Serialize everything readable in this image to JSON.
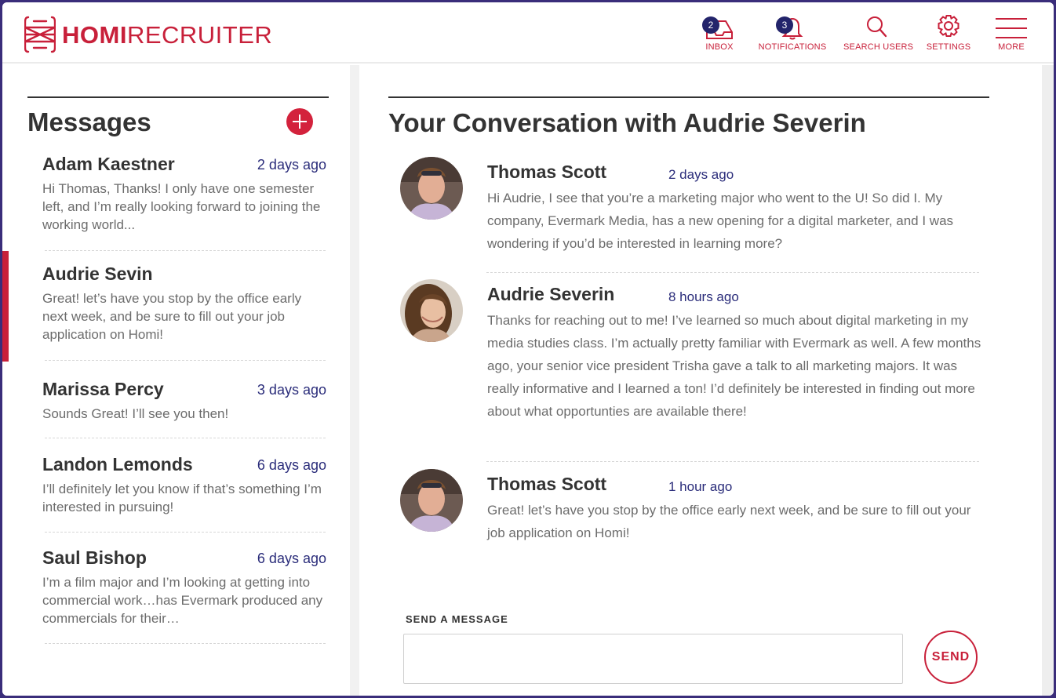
{
  "brand": {
    "part1": "HOMI",
    "part2": "RECRUITER",
    "accent": "#c8203a",
    "navy": "#23246b"
  },
  "nav": {
    "inbox": {
      "label": "INBOX",
      "badge": "2",
      "icon": "inbox-icon"
    },
    "notifications": {
      "label": "NOTIFICATIONS",
      "badge": "3",
      "icon": "bell-icon"
    },
    "search": {
      "label": "SEARCH USERS",
      "icon": "search-icon"
    },
    "settings": {
      "label": "SETTINGS",
      "icon": "gear-icon"
    },
    "more": {
      "label": "MORE",
      "icon": "hamburger-icon"
    }
  },
  "messages": {
    "title": "Messages",
    "threads": [
      {
        "name": "Adam Kaestner",
        "time": "2 days ago",
        "preview": "Hi Thomas, Thanks! I only have one semester left, and I’m really looking forward to joining the working world..."
      },
      {
        "name": "Audrie Sevin",
        "time": "",
        "preview": "Great! let’s have you stop by the  office early next week, and be sure to fill out your job application on Homi!"
      },
      {
        "name": "Marissa Percy",
        "time": "3 days ago",
        "preview": "Sounds Great! I’ll see you then!"
      },
      {
        "name": "Landon Lemonds",
        "time": "6 days ago",
        "preview": "I’ll definitely let you know if that’s something I’m interested in pursuing!"
      },
      {
        "name": "Saul Bishop",
        "time": "6 days ago",
        "preview": "I’m a film major and I’m looking at getting into commercial work…has Evermark produced any commercials for their…"
      }
    ]
  },
  "conversation": {
    "title": "Your Conversation with Audrie Severin",
    "messages": [
      {
        "sender": "Thomas Scott",
        "time": "2 days ago",
        "body": "Hi Audrie, I see that you’re a marketing major who went to the U! So did I. My company,  Evermark Media, has a new opening for a digital marketer, and I was wondering if you’d be interested in learning more?"
      },
      {
        "sender": "Audrie Severin",
        "time": "8 hours ago",
        "body": "Thanks for reaching out to me! I’ve learned so much about digital marketing in my media studies class. I’m actually pretty familiar with Evermark as well. A few months ago, your senior vice president Trisha gave a talk to all marketing majors. It was really informative and I learned a ton! I’d definitely be interested in finding out more about what opportunties are available there!"
      },
      {
        "sender": "Thomas Scott",
        "time": "1 hour ago",
        "body": "Great! let’s have you stop by the  office early next week, and be sure to fill out your job application on Homi!"
      }
    ]
  },
  "composer": {
    "label": "SEND A MESSAGE",
    "value": "",
    "send_label": "SEND"
  }
}
